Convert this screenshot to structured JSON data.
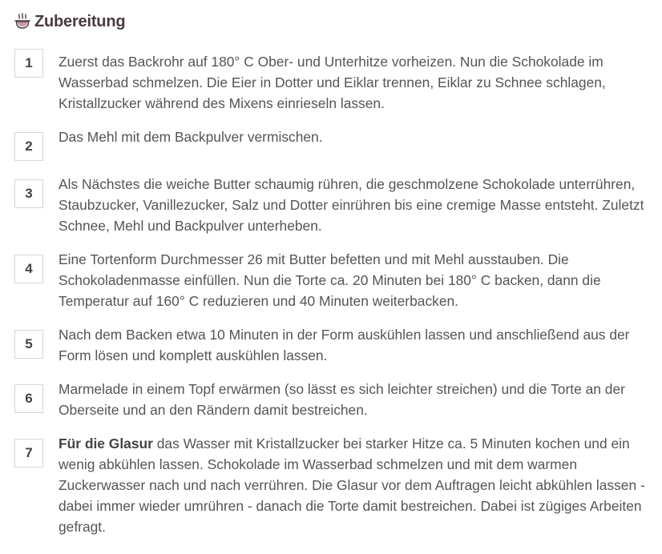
{
  "header": {
    "title": "Zubereitung",
    "icon": "cooking-pot-icon"
  },
  "steps": [
    {
      "number": "1",
      "text": "Zuerst das Backrohr auf 180° C Ober- und Unterhitze vorheizen. Nun die Schokolade im Wasserbad schmelzen. Die Eier in Dotter und Eiklar trennen, Eiklar zu Schnee schlagen, Kristallzucker während des Mixens einrieseln lassen."
    },
    {
      "number": "2",
      "text": "Das Mehl mit dem Backpulver vermischen."
    },
    {
      "number": "3",
      "text": "Als Nächstes die weiche Butter schaumig rühren, die geschmolzene Schokolade unterrühren, Staubzucker, Vanillezucker, Salz und Dotter einrühren bis eine cremige Masse entsteht. Zuletzt Schnee, Mehl und Backpulver unterheben."
    },
    {
      "number": "4",
      "text": "Eine Tortenform Durchmesser 26 mit Butter befetten und mit Mehl ausstauben. Die Schokoladenmasse einfüllen. Nun die Torte ca. 20 Minuten bei 180° C backen, dann die Temperatur auf 160° C reduzieren und 40 Minuten weiterbacken."
    },
    {
      "number": "5",
      "text": "Nach dem Backen etwa 10 Minuten in der Form auskühlen lassen und anschließend aus der Form lösen und komplett auskühlen lassen."
    },
    {
      "number": "6",
      "text": "Marmelade in einem Topf erwärmen (so lässt es sich leichter streichen) und die Torte an der Oberseite und an den Rändern damit bestreichen."
    },
    {
      "number": "7",
      "bold_lead": "Für die Glasur",
      "text": " das Wasser mit Kristallzucker bei starker Hitze ca. 5 Minuten kochen und ein wenig abkühlen lassen. Schokolade im Wasserbad schmelzen und mit dem warmen Zuckerwasser nach und nach verrühren. Die Glasur vor dem Auftragen leicht abkühlen lassen - dabei immer wieder umrühren - danach die Torte damit bestreichen. Dabei ist zügiges Arbeiten gefragt."
    }
  ]
}
